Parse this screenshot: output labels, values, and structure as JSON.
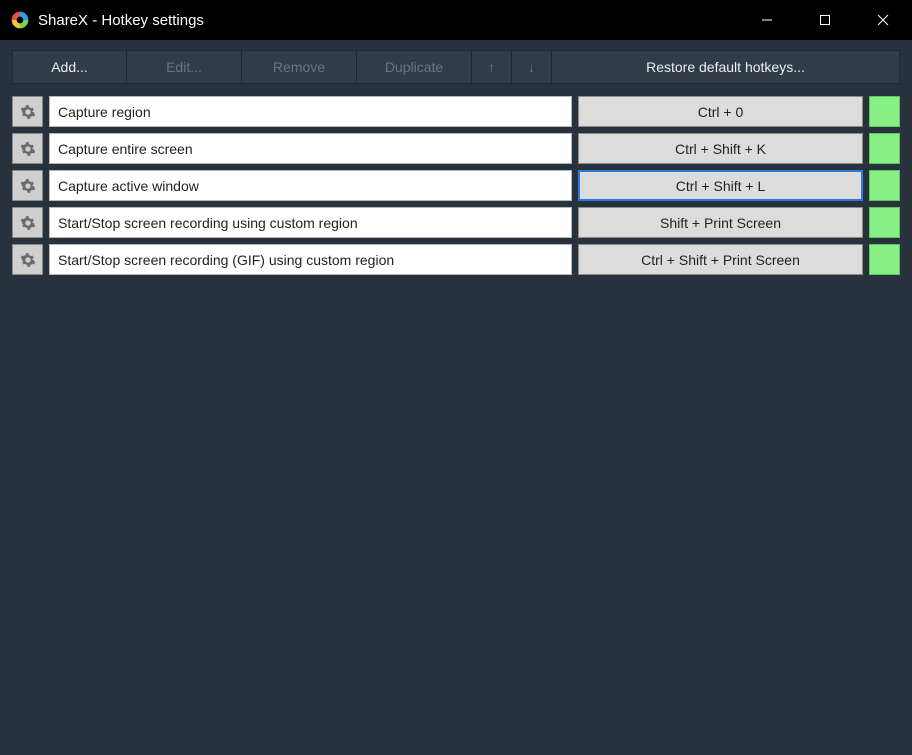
{
  "window": {
    "title": "ShareX - Hotkey settings"
  },
  "toolbar": {
    "add": "Add...",
    "edit": "Edit...",
    "remove": "Remove",
    "duplicate": "Duplicate",
    "up": "↑",
    "down": "↓",
    "restore": "Restore default hotkeys..."
  },
  "rows": [
    {
      "task": "Capture region",
      "hotkey": "Ctrl + 0",
      "selected": false,
      "status": "ok"
    },
    {
      "task": "Capture entire screen",
      "hotkey": "Ctrl + Shift + K",
      "selected": false,
      "status": "ok"
    },
    {
      "task": "Capture active window",
      "hotkey": "Ctrl + Shift + L",
      "selected": true,
      "status": "ok"
    },
    {
      "task": "Start/Stop screen recording using custom region",
      "hotkey": "Shift + Print Screen",
      "selected": false,
      "status": "ok"
    },
    {
      "task": "Start/Stop screen recording (GIF) using custom region",
      "hotkey": "Ctrl + Shift + Print Screen",
      "selected": false,
      "status": "ok"
    }
  ],
  "colors": {
    "status_ok": "#86f086",
    "selection": "#2a7bdc"
  }
}
